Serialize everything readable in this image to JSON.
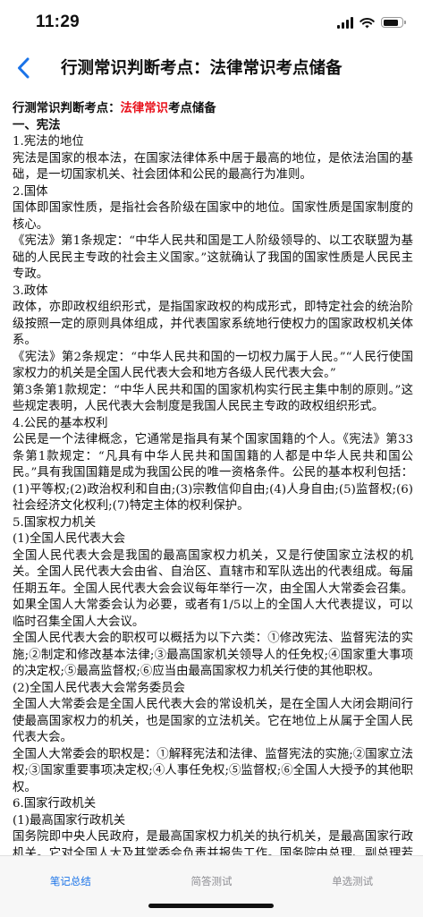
{
  "status_bar": {
    "time": "11:29",
    "battery_level": 0.85,
    "signal_bars": 4
  },
  "nav": {
    "title": "行测常识判断考点：法律常识考点储备",
    "back_icon": "chevron-left-icon",
    "accent": "#1a73e8"
  },
  "content": {
    "heading_prefix": "行测常识判断考点：",
    "heading_highlight": "法律常识",
    "heading_suffix": "考点储备",
    "highlight_color": "#e8101a",
    "section_title": "一、宪法",
    "paragraphs": [
      "1.宪法的地位",
      "宪法是国家的根本法，在国家法律体系中居于最高的地位，是依法治国的基础，是一切国家机关、社会团体和公民的最高行为准则。",
      "2.国体",
      "国体即国家性质，是指社会各阶级在国家中的地位。国家性质是国家制度的核心。",
      "《宪法》第1条规定：“中华人民共和国是工人阶级领导的、以工农联盟为基础的人民民主专政的社会主义国家。”这就确认了我国的国家性质是人民民主专政。",
      "3.政体",
      "政体，亦即政权组织形式，是指国家政权的构成形式，即特定社会的统治阶级按照一定的原则具体组成，并代表国家系统地行使权力的国家政权机关体系。",
      "《宪法》第2条规定：“中华人民共和国的一切权力属于人民。”“人民行使国家权力的机关是全国人民代表大会和地方各级人民代表大会。”",
      "第3条第1款规定：“中华人民共和国的国家机构实行民主集中制的原则。”这些规定表明，人民代表大会制度是我国人民民主专政的政权组织形式。",
      "4.公民的基本权利",
      "公民是一个法律概念，它通常是指具有某个国家国籍的个人。《宪法》第33条第1款规定：“凡具有中华人民共和国国籍的人都是中华人民共和国公民。”具有我国国籍是成为我国公民的唯一资格条件。公民的基本权利包括：(1)平等权;(2)政治权利和自由;(3)宗教信仰自由;(4)人身自由;(5)监督权;(6)社会经济文化权利;(7)特定主体的权利保护。",
      "5.国家权力机关",
      "(1)全国人民代表大会",
      "全国人民代表大会是我国的最高国家权力机关，又是行使国家立法权的机关。全国人民代表大会由省、自治区、直辖市和军队选出的代表组成。每届任期五年。全国人民代表大会会议每年举行一次，由全国人大常委会召集。如果全国人大常委会认为必要，或者有1/5以上的全国人大代表提议，可以临时召集全国人大会议。",
      "全国人民代表大会的职权可以概括为以下六类：①修改宪法、监督宪法的实施;②制定和修改基本法律;③最高国家机关领导人的任免权;④国家重大事项的决定权;⑤最高监督权;⑥应当由最高国家权力机关行使的其他职权。",
      "(2)全国人民代表大会常务委员会",
      "全国人大常委会是全国人民代表大会的常设机关，是在全国人大闭会期间行使最高国家权力的机关，也是国家的立法机关。它在地位上从属于全国人民代表大会。",
      "全国人大常委会的职权是：①解释宪法和法律、监督宪法的实施;②国家立法权;③国家重要事项决定权;④人事任免权;⑤监督权;⑥全国人大授予的其他职权。",
      "6.国家行政机关",
      "(1)最高国家行政机关",
      "国务院即中央人民政府，是最高国家权力机关的执行机关，是最高国家行政机关。它对全国人大及其常委会负责并报告工作。国务院由总理、副总理若干人、国务委员若干人、各部部长、各委员会主任、审计长、秘书长组成。"
    ]
  },
  "tabs": [
    {
      "label": "笔记总结",
      "active": true
    },
    {
      "label": "简答测试",
      "active": false
    },
    {
      "label": "单选测试",
      "active": false
    }
  ]
}
